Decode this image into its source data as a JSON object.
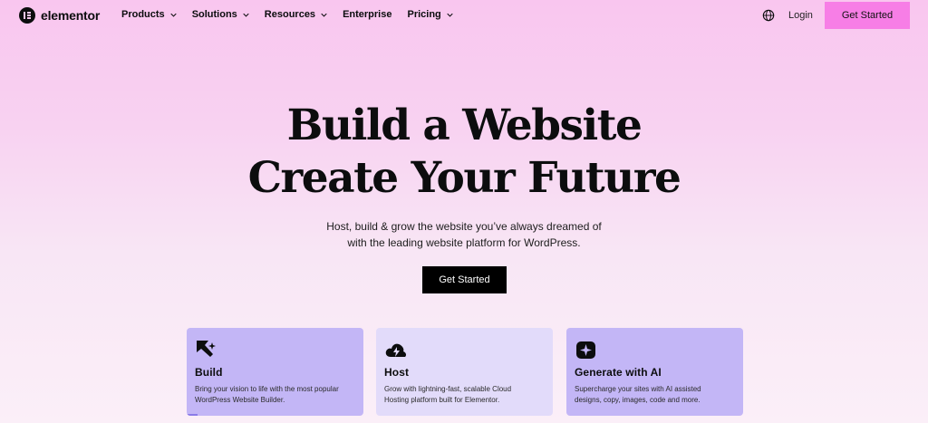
{
  "nav": {
    "brand": "elementor",
    "menu": [
      {
        "label": "Products",
        "has_dropdown": true
      },
      {
        "label": "Solutions",
        "has_dropdown": true
      },
      {
        "label": "Resources",
        "has_dropdown": true
      },
      {
        "label": "Enterprise",
        "has_dropdown": false
      },
      {
        "label": "Pricing",
        "has_dropdown": true
      }
    ],
    "login_label": "Login",
    "cta_label": "Get Started",
    "icons": {
      "globe": "globe-icon"
    }
  },
  "hero": {
    "headline_line1": "Build a Website",
    "headline_line2": "Create Your Future",
    "subtitle_line1": "Host, build & grow the website you’ve always dreamed of",
    "subtitle_line2": "with the leading website platform for WordPress.",
    "cta_label": "Get Started"
  },
  "cards": [
    {
      "icon": "build-cursor-icon",
      "title": "Build",
      "desc_line1": "Bring your vision to life with the most popular",
      "desc_line2": "WordPress Website Builder."
    },
    {
      "icon": "cloud-lightning-icon",
      "title": "Host",
      "desc_line1": "Grow with lightning-fast, scalable Cloud",
      "desc_line2": "Hosting platform built for Elementor."
    },
    {
      "icon": "ai-sparkle-icon",
      "title": "Generate with AI",
      "desc_line1": "Supercharge your sites with AI assisted",
      "desc_line2": "designs, copy, images, code and more."
    }
  ],
  "colors": {
    "accent_pink": "#f77ee6",
    "card_purple": "#c3b6f6",
    "card_light": "#e2dbfa",
    "text_dark": "#0c0d0e"
  }
}
